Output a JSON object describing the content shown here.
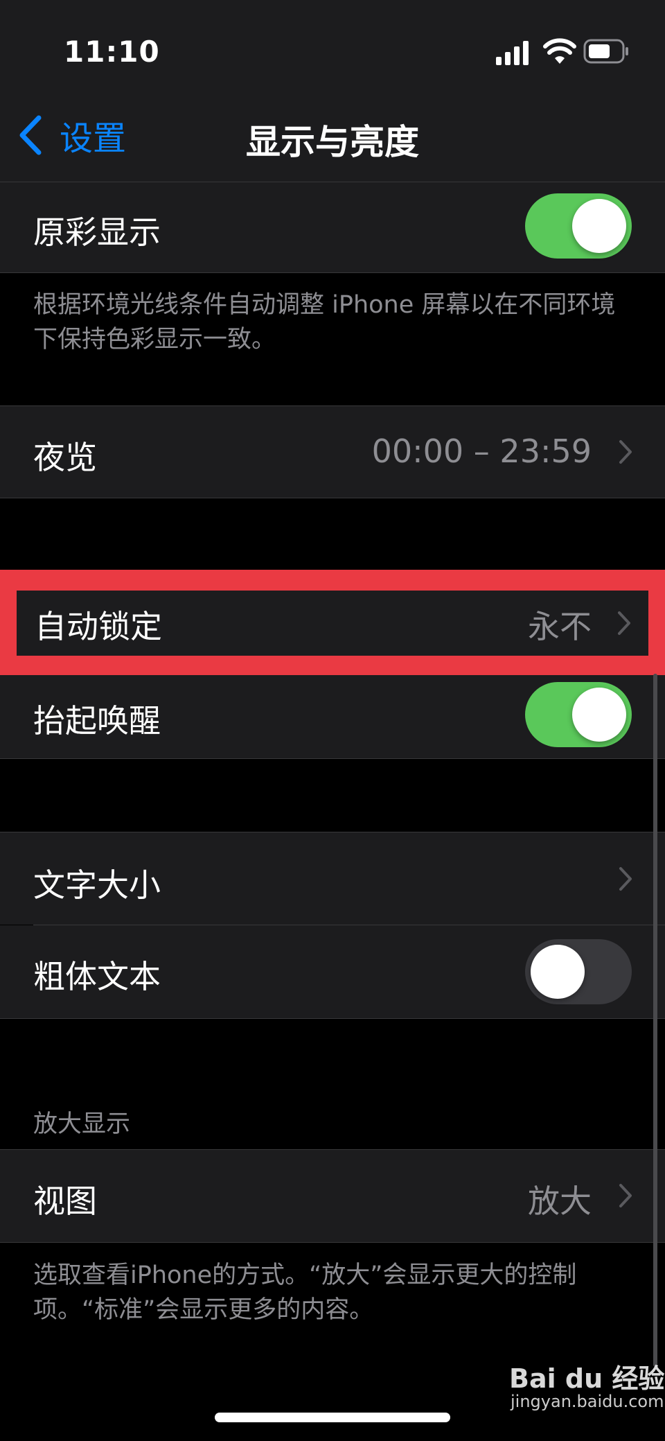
{
  "status_bar": {
    "time": "11:10",
    "signal_icon": "cellular-signal-icon",
    "wifi_icon": "wifi-icon",
    "battery_icon": "battery-icon"
  },
  "nav": {
    "back_label": "设置",
    "title": "显示与亮度",
    "back_icon": "chevron-left-icon"
  },
  "true_tone": {
    "label": "原彩显示",
    "enabled": true,
    "footnote": "根据环境光线条件自动调整 iPhone 屏幕以在不同环境下保持色彩显示一致。"
  },
  "night_shift": {
    "label": "夜览",
    "value": "00:00 – 23:59"
  },
  "auto_lock": {
    "label": "自动锁定",
    "value": "永不",
    "highlighted": true
  },
  "raise_to_wake": {
    "label": "抬起唤醒",
    "enabled": true
  },
  "text_size": {
    "label": "文字大小"
  },
  "bold_text": {
    "label": "粗体文本",
    "enabled": false
  },
  "display_zoom": {
    "header": "放大显示",
    "view_label": "视图",
    "view_value": "放大",
    "footnote": "选取查看iPhone的方式。“放大”会显示更大的控制项。“标准”会显示更多的内容。"
  },
  "watermark": {
    "brand": "Bai du 经验",
    "url": "jingyan.baidu.com"
  },
  "colors": {
    "accent": "#0a84ff",
    "toggle_on": "#5ac85a",
    "highlight": "#ea3a43",
    "row_bg": "#1c1c1e"
  }
}
